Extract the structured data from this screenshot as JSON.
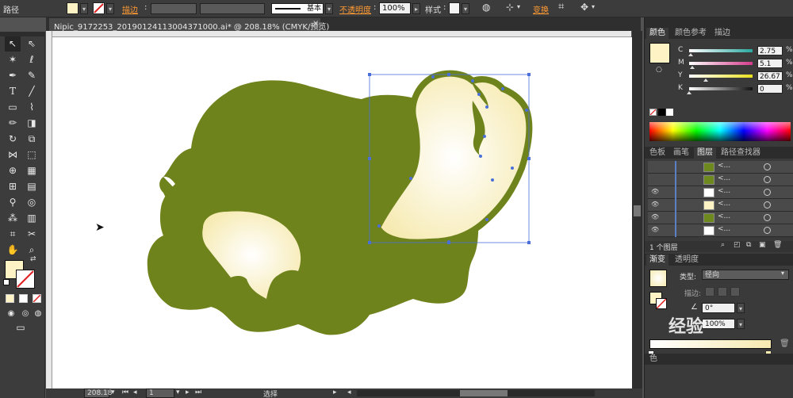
{
  "control_bar": {
    "selection_label": "路径",
    "stroke_label": "描边",
    "stroke_style_label": "基本",
    "opacity_label": "不透明度",
    "opacity_value": "100%",
    "style_label": "样式",
    "transform_label": "变换"
  },
  "document": {
    "tab_title": "Nipic_9172253_20190124113004371000.ai* @ 208.18% (CMYK/预览)",
    "close_glyph": "×",
    "zoom_value": "208.18",
    "artboard_value": "1",
    "status_text": "选择"
  },
  "color_panel": {
    "tabs": [
      "颜色",
      "颜色参考",
      "描边"
    ],
    "channels": [
      {
        "label": "C",
        "value": "2.75",
        "unit": "%",
        "level": 0.0275,
        "color": "#2aa7a0"
      },
      {
        "label": "M",
        "value": "5.1",
        "unit": "%",
        "level": 0.051,
        "color": "#d43c8c"
      },
      {
        "label": "Y",
        "value": "26.67",
        "unit": "%",
        "level": 0.2667,
        "color": "#e8e020"
      },
      {
        "label": "K",
        "value": "0",
        "unit": "%",
        "level": 0.0,
        "color": "#111111"
      }
    ],
    "fill_color": "#fdf3c4"
  },
  "layers_panel": {
    "tabs": [
      "色板",
      "画笔",
      "图层",
      "路径查找器"
    ],
    "footer_label": "1 个图层",
    "rows": [
      {
        "name": "<...",
        "visible": false,
        "thumb": "#6e8a1e"
      },
      {
        "name": "<...",
        "visible": false,
        "thumb": "#6e8a1e"
      },
      {
        "name": "<...",
        "visible": true,
        "thumb": "#ffffff"
      },
      {
        "name": "<...",
        "visible": true,
        "thumb": "#fdf3c4"
      },
      {
        "name": "<...",
        "visible": true,
        "thumb": "#6e8a1e"
      },
      {
        "name": "<...",
        "visible": true,
        "thumb": "#ffffff"
      }
    ]
  },
  "gradient_panel": {
    "tabs": [
      "渐变",
      "透明度"
    ],
    "type_label": "类型:",
    "type_value": "径向",
    "stroke_label": "描边:",
    "angle_value": "0°",
    "scale_value": "100%",
    "next_tab_label": "色"
  },
  "watermark": "经验",
  "colors": {
    "shell_green": "#6f831d",
    "cream": "#fdf3c4",
    "selection_blue": "#4a6fd8"
  }
}
